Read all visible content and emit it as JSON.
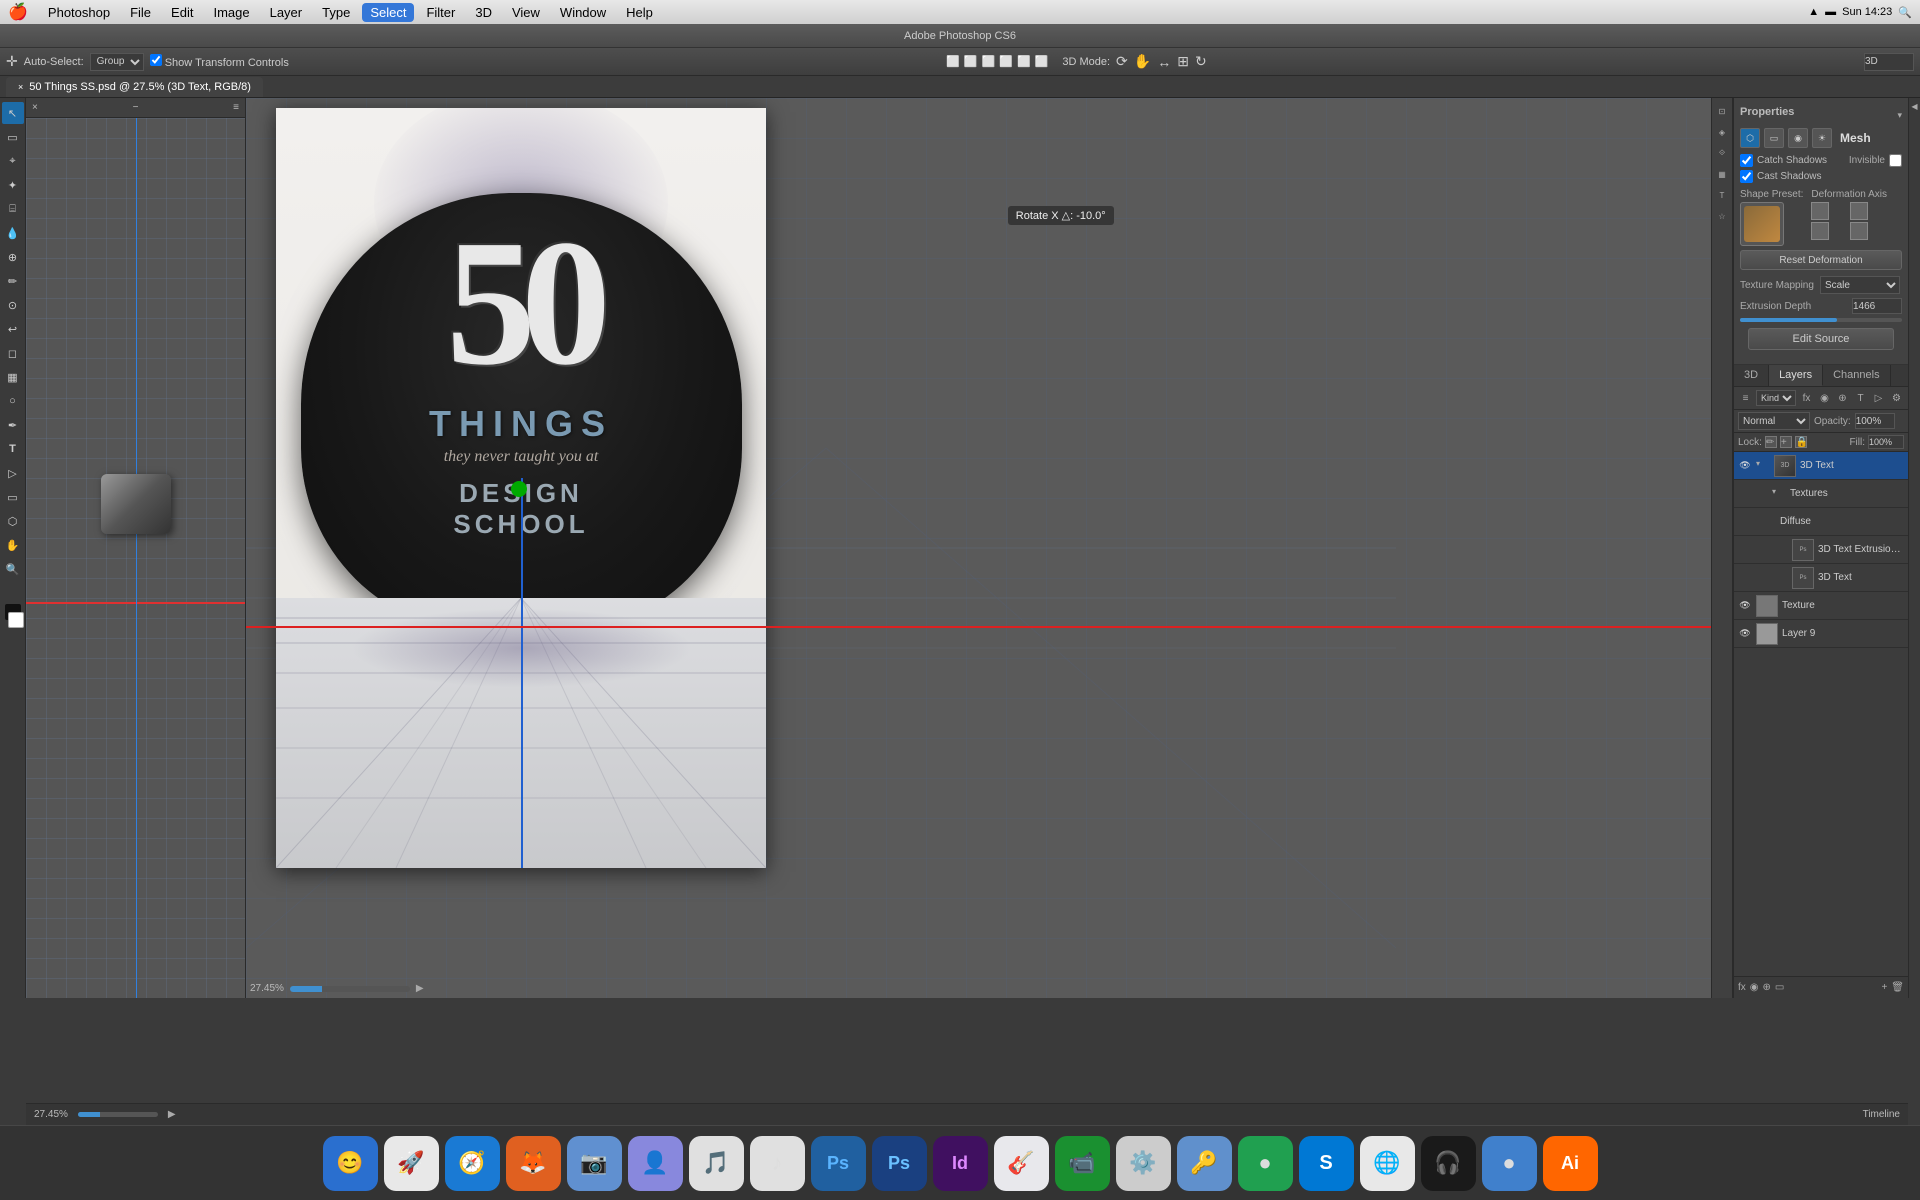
{
  "app": {
    "title": "Adobe Photoshop CS6",
    "window_title": "Adobe Photoshop CS6"
  },
  "menubar": {
    "apple": "🍎",
    "items": [
      "Photoshop",
      "File",
      "Edit",
      "Image",
      "Layer",
      "Type",
      "Select",
      "Filter",
      "3D",
      "View",
      "Window",
      "Help"
    ],
    "active": "Select",
    "time": "Sun 14:23",
    "icons": [
      "wifi",
      "battery",
      "volume"
    ]
  },
  "toolbar_3d": {
    "mode_label": "3D Mode:",
    "label_3d": "3D"
  },
  "options": {
    "auto_select": "Auto-Select:",
    "group": "Group",
    "show_transform": "Show Transform Controls",
    "mode_3d": "3D Mode:"
  },
  "document_tab": {
    "title": "50 Things SS.psd @ 27.5% (3D Text, RGB/8)",
    "close": "×"
  },
  "canvas": {
    "rotate_tooltip": "Rotate X △: -10.0°",
    "zoom": "27.45%"
  },
  "properties_panel": {
    "title": "Properties",
    "mesh_label": "Mesh",
    "catch_shadows_label": "Catch Shadows",
    "invisible_label": "Invisible",
    "cast_shadows_label": "Cast Shadows",
    "shape_preset_label": "Shape Preset:",
    "deformation_axis_label": "Deformation Axis",
    "reset_deformation_label": "Reset Deformation",
    "texture_mapping_label": "Texture Mapping",
    "texture_mapping_value": "Scale",
    "extrusion_depth_label": "Extrusion Depth",
    "extrusion_depth_value": "1466",
    "edit_source_label": "Edit Source"
  },
  "panel_tabs": {
    "items": [
      "3D",
      "Layers",
      "Channels"
    ]
  },
  "layers": {
    "title": "Layers",
    "blend_mode": "Normal",
    "opacity_label": "Opacity:",
    "opacity_value": "100%",
    "fill_label": "Fill:",
    "fill_value": "100%",
    "lock_label": "Lock:",
    "items": [
      {
        "name": "3D Text",
        "type": "3d",
        "visible": true,
        "selected": true,
        "children": [
          {
            "name": "Textures",
            "type": "folder",
            "expanded": true,
            "children": [
              {
                "name": "Diffuse",
                "type": "text",
                "children": [
                  {
                    "name": "3D Text Extrusion Ma...",
                    "type": "layer"
                  },
                  {
                    "name": "3D Text",
                    "type": "layer"
                  }
                ]
              }
            ]
          }
        ]
      },
      {
        "name": "Texture",
        "type": "layer",
        "visible": true
      },
      {
        "name": "Layer 9",
        "type": "layer",
        "visible": true
      }
    ]
  },
  "timeline": {
    "label": "Timeline",
    "progress": 27
  },
  "statusbar": {
    "zoom": "27.45%"
  },
  "dock": {
    "items": [
      {
        "name": "finder",
        "icon": "🔵"
      },
      {
        "name": "launchpad",
        "icon": "🚀"
      },
      {
        "name": "safari",
        "icon": "🧭"
      },
      {
        "name": "firefox",
        "icon": "🦊"
      },
      {
        "name": "photos",
        "icon": "📷"
      },
      {
        "name": "contacts",
        "icon": "👤"
      },
      {
        "name": "mail",
        "icon": "✉️"
      },
      {
        "name": "itunes",
        "icon": "🎵"
      },
      {
        "name": "ps-icon",
        "icon": "Ps"
      },
      {
        "name": "ps2",
        "icon": "Ps"
      },
      {
        "name": "indesign",
        "icon": "Id"
      },
      {
        "name": "itunes2",
        "icon": "🎵"
      },
      {
        "name": "facetime",
        "icon": "📹"
      },
      {
        "name": "app8",
        "icon": "🔷"
      },
      {
        "name": "keychain",
        "icon": "🔑"
      },
      {
        "name": "app9",
        "icon": "🟢"
      },
      {
        "name": "skype",
        "icon": "S"
      },
      {
        "name": "chrome",
        "icon": "🌐"
      },
      {
        "name": "spotify",
        "icon": "🎧"
      },
      {
        "name": "app10",
        "icon": "🔵"
      },
      {
        "name": "ai",
        "icon": "Ai"
      }
    ]
  }
}
